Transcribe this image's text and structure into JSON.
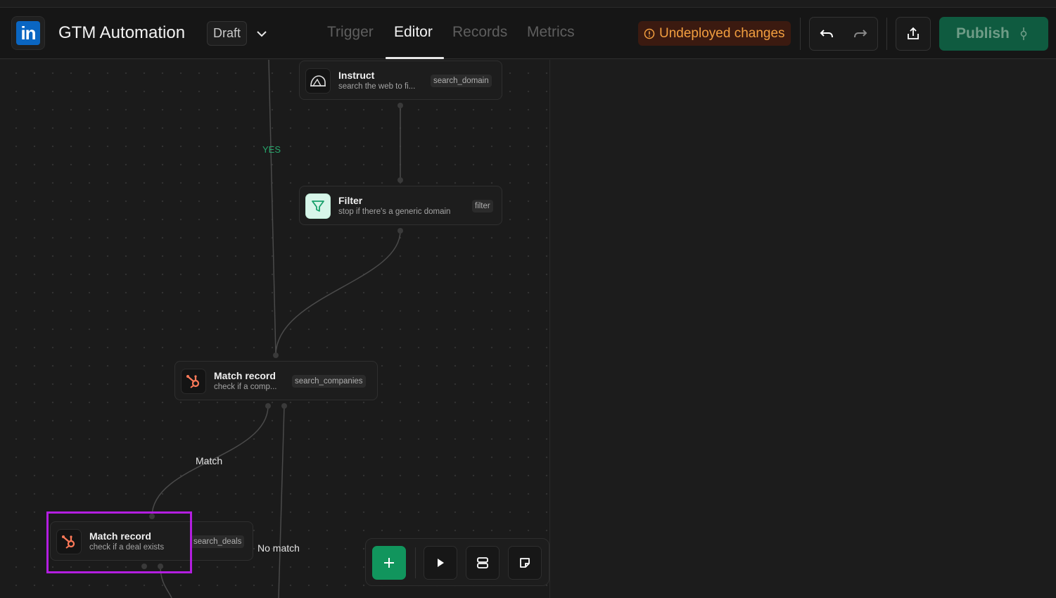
{
  "header": {
    "title": "GTM Automation",
    "status": "Draft",
    "tabs": [
      {
        "label": "Trigger",
        "active": false
      },
      {
        "label": "Editor",
        "active": true
      },
      {
        "label": "Records",
        "active": false
      },
      {
        "label": "Metrics",
        "active": false
      }
    ],
    "warning": "Undeployed changes",
    "publish_label": "Publish",
    "icons": {
      "logo": "linkedin-logo",
      "dropdown": "chevron-down-icon",
      "warning": "info-circle-icon",
      "undo": "undo-icon",
      "redo": "redo-icon",
      "share": "share-icon",
      "publish": "commit-icon"
    }
  },
  "workflow": {
    "nodes": [
      {
        "title": "Instruct",
        "subtitle": "search the web to fi...",
        "tag": "search_domain",
        "icon": "ai-cloud-icon"
      },
      {
        "title": "Filter",
        "subtitle": "stop if there's a generic domain",
        "tag": "filter",
        "icon": "filter-icon"
      },
      {
        "title": "Match record",
        "subtitle": "check if a comp...",
        "tag": "search_companies",
        "icon": "hubspot-icon"
      },
      {
        "title": "Match record",
        "subtitle": "check if a deal exists",
        "tag": "search_deals",
        "icon": "hubspot-icon",
        "selected": true
      }
    ],
    "edge_labels": {
      "yes": "YES",
      "match": "Match",
      "no_match": "No match"
    }
  },
  "toolbar": {
    "buttons": [
      "add-node-button",
      "run-button",
      "layers-button",
      "note-button"
    ]
  },
  "colors": {
    "accent_green": "#11955d",
    "warning_text": "#f29e3f",
    "selection": "#b31ee0",
    "hubspot": "#ff7a59",
    "linkedin": "#0a66c2"
  }
}
